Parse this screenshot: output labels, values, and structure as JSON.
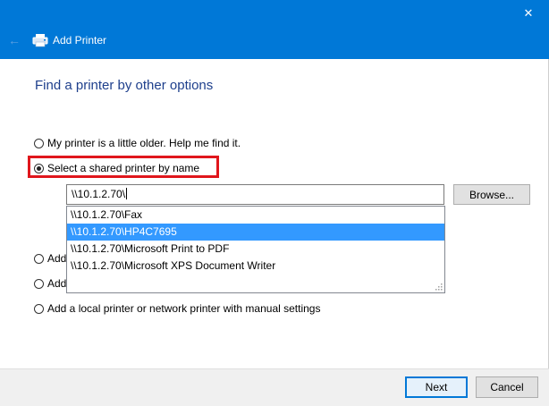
{
  "window": {
    "title": "Add Printer",
    "close_glyph": "✕",
    "back_glyph": "←",
    "icons": {
      "printer": "printer-icon",
      "back": "back-arrow-icon",
      "close": "close-icon",
      "grip": "resize-grip-icon"
    }
  },
  "heading": "Find a printer by other options",
  "options": [
    {
      "label": "My printer is a little older. Help me find it.",
      "checked": false
    },
    {
      "label": "Select a shared printer by name",
      "checked": true
    },
    {
      "label": "Add",
      "checked": false
    },
    {
      "label": "Add",
      "checked": false
    },
    {
      "label": "Add a local printer or network printer with manual settings",
      "checked": false
    }
  ],
  "shared_printer_input": {
    "value": "\\\\10.1.2.70\\"
  },
  "browse_label": "Browse...",
  "suggestions": [
    {
      "label": "\\\\10.1.2.70\\Fax",
      "selected": false
    },
    {
      "label": "\\\\10.1.2.70\\HP4C7695",
      "selected": true
    },
    {
      "label": "\\\\10.1.2.70\\Microsoft Print to PDF",
      "selected": false
    },
    {
      "label": "\\\\10.1.2.70\\Microsoft XPS Document Writer",
      "selected": false
    }
  ],
  "footer": {
    "next_label": "Next",
    "cancel_label": "Cancel"
  },
  "colors": {
    "titlebar": "#0078d7",
    "heading": "#1e3f8c",
    "highlight": "#e0161c",
    "selection": "#3399ff"
  }
}
